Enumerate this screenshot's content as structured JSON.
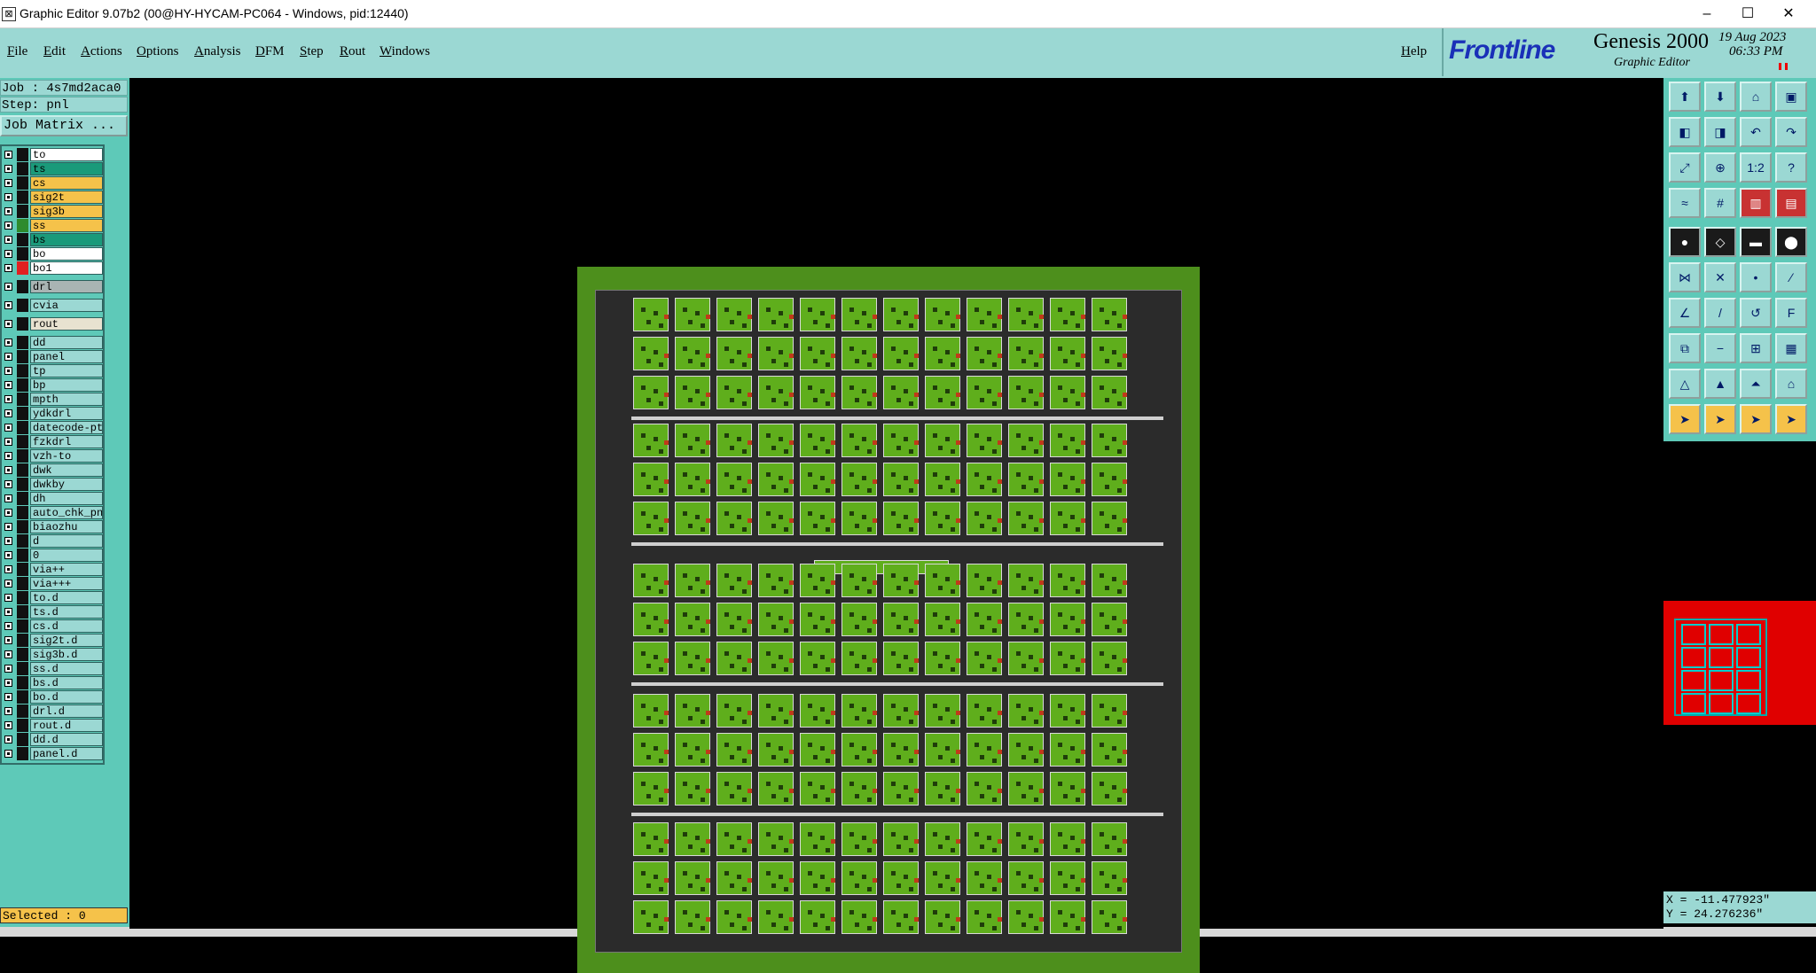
{
  "window": {
    "title": "Graphic Editor 9.07b2 (00@HY-HYCAM-PC064 - Windows, pid:12440)",
    "controls": {
      "minimize": "–",
      "maximize": "☐",
      "close": "✕"
    }
  },
  "menu": {
    "items": [
      "File",
      "Edit",
      "Actions",
      "Options",
      "Analysis",
      "DFM",
      "Step",
      "Rout",
      "Windows"
    ],
    "help": "Help"
  },
  "branding": {
    "frontline": "Frontline",
    "product": "Genesis 2000",
    "subtitle": "Graphic Editor",
    "date": "19 Aug 2023",
    "time": "06:33 PM"
  },
  "left": {
    "job_label": "Job : 4s7md2aca0",
    "step_label": "Step: pnl",
    "job_matrix": "Job Matrix ...",
    "selected": "Selected : 0"
  },
  "layers": [
    {
      "name": "to",
      "bg": "#ffffff",
      "swatch": "#111111"
    },
    {
      "name": "ts",
      "bg": "#1a9a7a",
      "swatch": "#111111"
    },
    {
      "name": "cs",
      "bg": "#f5c24a",
      "swatch": "#111111"
    },
    {
      "name": "sig2t",
      "bg": "#f5c24a",
      "swatch": "#111111"
    },
    {
      "name": "sig3b",
      "bg": "#f5c24a",
      "swatch": "#111111"
    },
    {
      "name": "ss",
      "bg": "#f5c24a",
      "swatch": "#2e8b2e"
    },
    {
      "name": "bs",
      "bg": "#1a9a7a",
      "swatch": "#111111"
    },
    {
      "name": "bo",
      "bg": "#ffffff",
      "swatch": "#111111"
    },
    {
      "name": "bo1",
      "bg": "#ffffff",
      "swatch": "#e02020"
    },
    {
      "name": "drl",
      "bg": "#a9b4b3",
      "swatch": "#111111"
    },
    {
      "name": "cvia",
      "bg": "#9bd8d3",
      "swatch": "#111111"
    },
    {
      "name": "rout",
      "bg": "#e8e2d0",
      "swatch": "#111111"
    },
    {
      "name": "dd",
      "bg": "#9bd8d3",
      "swatch": "#111111"
    },
    {
      "name": "panel",
      "bg": "#9bd8d3",
      "swatch": "#111111"
    },
    {
      "name": "tp",
      "bg": "#9bd8d3",
      "swatch": "#111111"
    },
    {
      "name": "bp",
      "bg": "#9bd8d3",
      "swatch": "#111111"
    },
    {
      "name": "mpth",
      "bg": "#9bd8d3",
      "swatch": "#111111"
    },
    {
      "name": "ydkdrl",
      "bg": "#9bd8d3",
      "swatch": "#111111"
    },
    {
      "name": "datecode-pto",
      "bg": "#9bd8d3",
      "swatch": "#111111"
    },
    {
      "name": "fzkdrl",
      "bg": "#9bd8d3",
      "swatch": "#111111"
    },
    {
      "name": "vzh-to",
      "bg": "#9bd8d3",
      "swatch": "#111111"
    },
    {
      "name": "dwk",
      "bg": "#9bd8d3",
      "swatch": "#111111"
    },
    {
      "name": "dwkby",
      "bg": "#9bd8d3",
      "swatch": "#111111"
    },
    {
      "name": "dh",
      "bg": "#9bd8d3",
      "swatch": "#111111"
    },
    {
      "name": "auto_chk_pnl",
      "bg": "#9bd8d3",
      "swatch": "#111111"
    },
    {
      "name": "biaozhu",
      "bg": "#9bd8d3",
      "swatch": "#111111"
    },
    {
      "name": "d",
      "bg": "#9bd8d3",
      "swatch": "#111111"
    },
    {
      "name": "0",
      "bg": "#9bd8d3",
      "swatch": "#111111"
    },
    {
      "name": "via++",
      "bg": "#9bd8d3",
      "swatch": "#111111"
    },
    {
      "name": "via+++",
      "bg": "#9bd8d3",
      "swatch": "#111111"
    },
    {
      "name": "to.d",
      "bg": "#9bd8d3",
      "swatch": "#111111"
    },
    {
      "name": "ts.d",
      "bg": "#9bd8d3",
      "swatch": "#111111"
    },
    {
      "name": "cs.d",
      "bg": "#9bd8d3",
      "swatch": "#111111"
    },
    {
      "name": "sig2t.d",
      "bg": "#9bd8d3",
      "swatch": "#111111"
    },
    {
      "name": "sig3b.d",
      "bg": "#9bd8d3",
      "swatch": "#111111"
    },
    {
      "name": "ss.d",
      "bg": "#9bd8d3",
      "swatch": "#111111"
    },
    {
      "name": "bs.d",
      "bg": "#9bd8d3",
      "swatch": "#111111"
    },
    {
      "name": "bo.d",
      "bg": "#9bd8d3",
      "swatch": "#111111"
    },
    {
      "name": "drl.d",
      "bg": "#9bd8d3",
      "swatch": "#111111"
    },
    {
      "name": "rout.d",
      "bg": "#9bd8d3",
      "swatch": "#111111"
    },
    {
      "name": "dd.d",
      "bg": "#9bd8d3",
      "swatch": "#111111"
    },
    {
      "name": "panel.d",
      "bg": "#9bd8d3",
      "swatch": "#111111"
    }
  ],
  "tools": [
    {
      "icon": "top-icon",
      "glyph": "⬆"
    },
    {
      "icon": "bottom-icon",
      "glyph": "⬇"
    },
    {
      "icon": "home-icon",
      "glyph": "⌂"
    },
    {
      "icon": "window-icon",
      "glyph": "▣"
    },
    {
      "icon": "left-icon",
      "glyph": "◧"
    },
    {
      "icon": "right-icon",
      "glyph": "◨"
    },
    {
      "icon": "undo-icon",
      "glyph": "↶"
    },
    {
      "icon": "redo-icon",
      "glyph": "↷"
    },
    {
      "icon": "fit-icon",
      "glyph": "⤢"
    },
    {
      "icon": "zoom-icon",
      "glyph": "⊕"
    },
    {
      "icon": "scale-icon",
      "glyph": "1:2"
    },
    {
      "icon": "help-icon",
      "glyph": "?"
    },
    {
      "icon": "measure-icon",
      "glyph": "≈"
    },
    {
      "icon": "grid-icon",
      "glyph": "#"
    },
    {
      "icon": "layer-icon",
      "glyph": "▥"
    },
    {
      "icon": "layers-icon",
      "glyph": "▤"
    },
    {
      "icon": "pad-icon",
      "glyph": "●"
    },
    {
      "icon": "surface-icon",
      "glyph": "◇"
    },
    {
      "icon": "line-icon",
      "glyph": "▬"
    },
    {
      "icon": "circle-icon",
      "glyph": "⬤"
    },
    {
      "icon": "connect-icon",
      "glyph": "⋈"
    },
    {
      "icon": "cross-icon",
      "glyph": "✕"
    },
    {
      "icon": "node-icon",
      "glyph": "•"
    },
    {
      "icon": "endpoint-icon",
      "glyph": "⁄"
    },
    {
      "icon": "edge-icon",
      "glyph": "∠"
    },
    {
      "icon": "slash-icon",
      "glyph": "/"
    },
    {
      "icon": "arc-icon",
      "glyph": "↺"
    },
    {
      "icon": "text-icon",
      "glyph": "F"
    },
    {
      "icon": "copy-icon",
      "glyph": "⧉"
    },
    {
      "icon": "minus-icon",
      "glyph": "−"
    },
    {
      "icon": "array-icon",
      "glyph": "⊞"
    },
    {
      "icon": "group-icon",
      "glyph": "▦"
    },
    {
      "icon": "triangle-icon",
      "glyph": "△"
    },
    {
      "icon": "triangle2-icon",
      "glyph": "▲"
    },
    {
      "icon": "triangle3-icon",
      "glyph": "⏶"
    },
    {
      "icon": "triangle4-icon",
      "glyph": "⌂"
    },
    {
      "icon": "pointer-icon",
      "glyph": "➤"
    },
    {
      "icon": "pointer2-icon",
      "glyph": "➤"
    },
    {
      "icon": "pointer3-icon",
      "glyph": "➤"
    },
    {
      "icon": "pointer4-icon",
      "glyph": "➤"
    }
  ],
  "coordinates": {
    "x": "X = -11.477923\"",
    "y": "Y = 24.276236\""
  }
}
